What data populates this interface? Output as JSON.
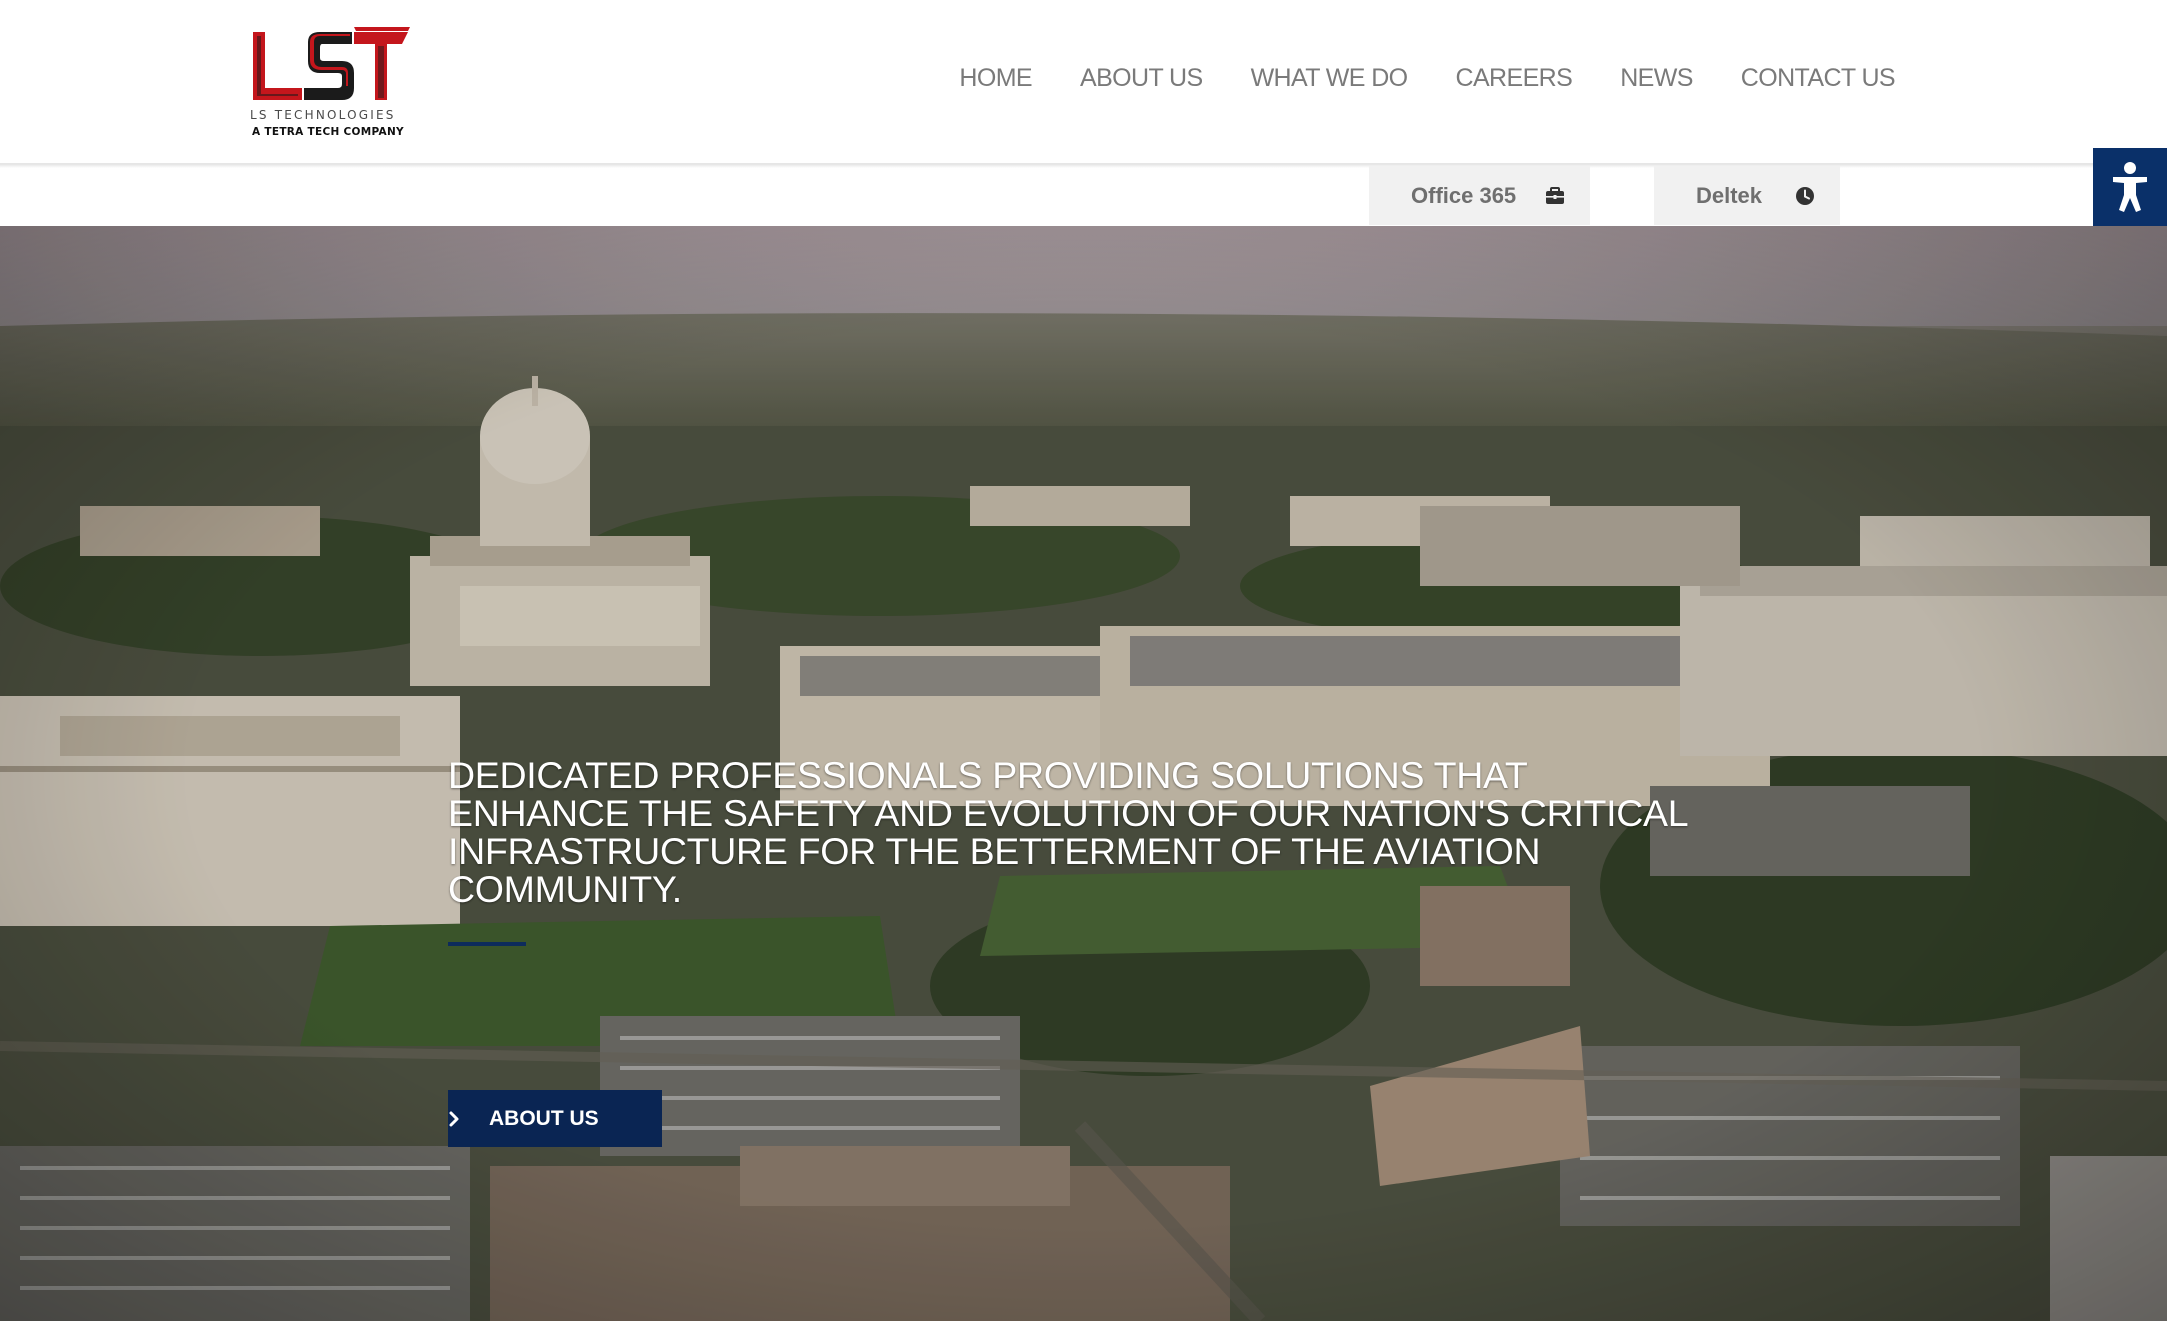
{
  "brand": {
    "logo_text": "LST",
    "tagline": "LS TECHNOLOGIES",
    "subtitle": "A TETRA TECH COMPANY",
    "colors": {
      "red": "#c4161c",
      "dark": "#1b1b1b",
      "navy": "#0a2553"
    }
  },
  "nav": {
    "items": [
      {
        "label": "HOME"
      },
      {
        "label": "ABOUT US"
      },
      {
        "label": "WHAT WE DO"
      },
      {
        "label": "CAREERS"
      },
      {
        "label": "NEWS"
      },
      {
        "label": "CONTACT US"
      }
    ]
  },
  "quick_links": {
    "office": {
      "label": "Office 365",
      "icon": "briefcase-icon"
    },
    "deltek": {
      "label": "Deltek",
      "icon": "clock-icon"
    }
  },
  "accessibility": {
    "icon": "accessibility-person-icon"
  },
  "hero": {
    "headline": "DEDICATED PROFESSIONALS PROVIDING SOLUTIONS THAT ENHANCE THE SAFETY AND EVOLUTION OF OUR NATION'S CRITICAL INFRASTRUCTURE FOR THE BETTERMENT OF THE AVIATION COMMUNITY.",
    "button_label": "ABOUT US",
    "button_icon": "chevron-right-icon",
    "background": "aerial-city-photo"
  }
}
